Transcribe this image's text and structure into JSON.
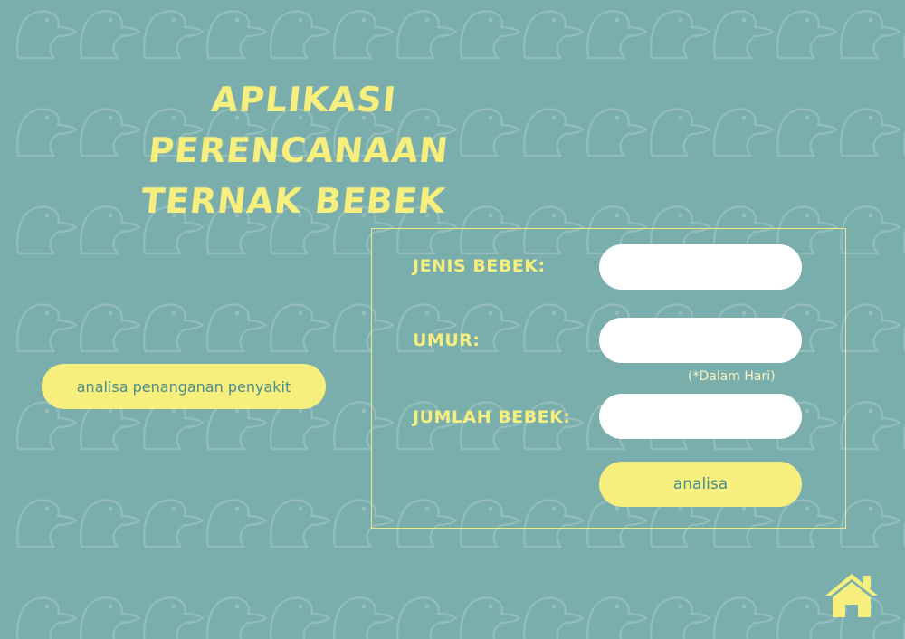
{
  "app": {
    "title_line1": "APLIKASI PERENCANAAN",
    "title_line2": "TERNAK BEBEK"
  },
  "form": {
    "jenis_label": "JENIS BEBEK:",
    "jenis_value": "",
    "umur_label": "UMUR:",
    "umur_value": "",
    "umur_note": "(*Dalam Hari)",
    "jumlah_label": "JUMLAH BEBEK:",
    "jumlah_value": "",
    "submit_label": "analisa"
  },
  "sidebar": {
    "disease_button_label": "analisa penanganan penyakit"
  },
  "icons": {
    "home": "home-icon",
    "background": "duck-head-icon"
  },
  "colors": {
    "background": "#7aaead",
    "accent_yellow": "#f6ef7d",
    "button_text": "#4a8c8f",
    "field": "#ffffff"
  }
}
